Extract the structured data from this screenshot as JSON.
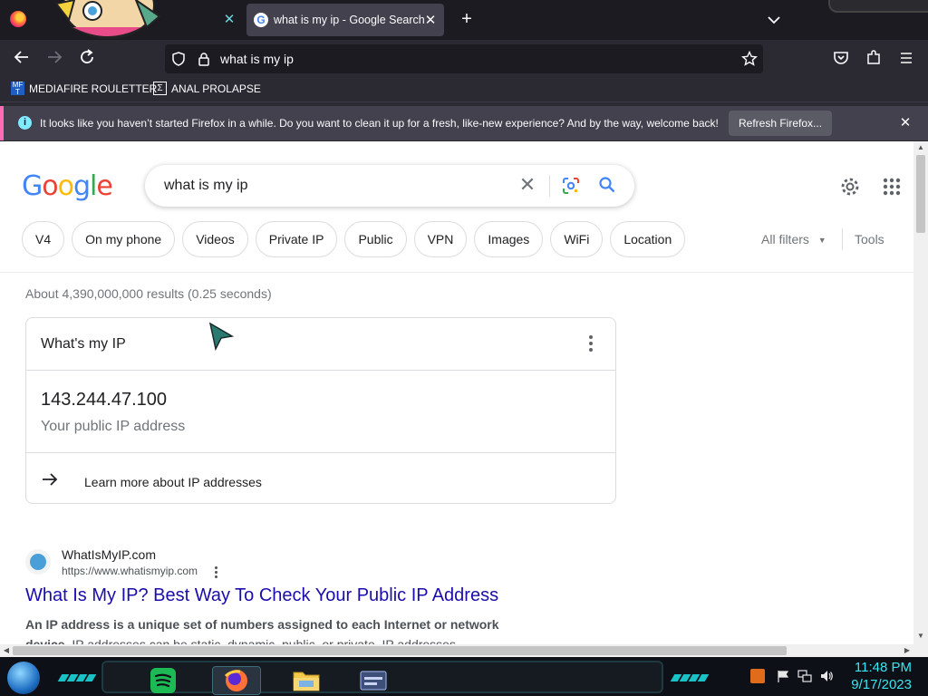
{
  "browser": {
    "tabs": [
      {
        "label": ""
      },
      {
        "label": "what is my ip - Google Search"
      }
    ],
    "url": "what is my ip",
    "bookmarks": [
      {
        "label": "MEDIAFIRE ROULETTER",
        "icon_text": "MF T"
      },
      {
        "label": "ANAL PROLAPSE"
      }
    ],
    "notification": {
      "message": "It looks like you haven’t started Firefox in a while. Do you want to clean it up for a fresh, like-new experience? And by the way, welcome back!",
      "button": "Refresh Firefox..."
    }
  },
  "google": {
    "logo_letters": [
      {
        "ch": "G",
        "color": "#4285F4"
      },
      {
        "ch": "o",
        "color": "#EA4335"
      },
      {
        "ch": "o",
        "color": "#FBBC05"
      },
      {
        "ch": "g",
        "color": "#4285F4"
      },
      {
        "ch": "l",
        "color": "#34A853"
      },
      {
        "ch": "e",
        "color": "#EA4335"
      }
    ],
    "query": "what is my ip",
    "chips": [
      "V4",
      "On my phone",
      "Videos",
      "Private IP",
      "Public",
      "VPN",
      "Images",
      "WiFi",
      "Location"
    ],
    "all_filters": "All filters",
    "tools": "Tools",
    "stats": "About 4,390,000,000 results (0.25 seconds)",
    "ip_card": {
      "heading": "What's my IP",
      "ip": "143.244.47.100",
      "subtitle": "Your public IP address",
      "learn_more": "Learn more about IP addresses"
    },
    "result": {
      "site": "WhatIsMyIP.com",
      "url": "https://www.whatismyip.com",
      "title": "What Is My IP? Best Way To Check Your Public IP Address",
      "snippet_bold": "An IP address is a unique set of numbers assigned to each Internet or network device",
      "snippet_rest": ". IP addresses can be static, dynamic, public, or private. IP addresses ..."
    }
  },
  "taskbar": {
    "time": "11:48 PM",
    "date": "9/17/2023",
    "apps": [
      "spotify-icon",
      "firefox-icon",
      "file-explorer-icon",
      "window-icon"
    ]
  },
  "colors": {
    "link": "#1a0dab",
    "accent": "#37e6f0",
    "notification_stripe": "#ff6bb5"
  }
}
